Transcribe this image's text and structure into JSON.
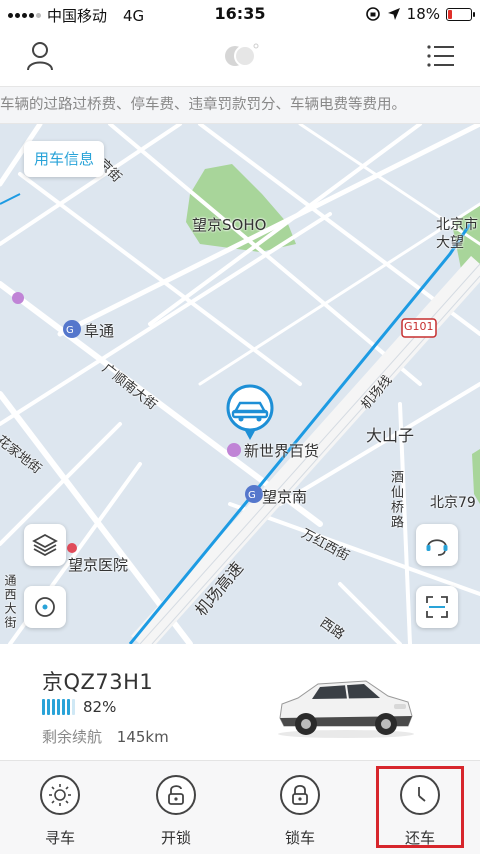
{
  "status_bar": {
    "carrier": "中国移动",
    "network": "4G",
    "time": "16:35",
    "battery": "18%",
    "battery_level": 0.18,
    "battery_color": "#e0302a"
  },
  "header": {
    "left_icon": "user-icon",
    "center_icon": "brand-logo",
    "right_icon": "menu-icon"
  },
  "notice": {
    "text": "车辆的过路过桥费、停车费、违章罚款罚分、车辆电费等费用。"
  },
  "map": {
    "usage_info_label": "用车信息",
    "labels": {
      "soho": "望京SOHO",
      "futong": "阜通",
      "xinshijie": "新世界百货",
      "dashanzi": "大山子",
      "wangjingnan": "望京南",
      "wangjing_hospital": "望京医院",
      "jichangxian": "机场线",
      "jichang_gaosu": "机场高速",
      "wanhong_xijie": "万红西街",
      "guangshun_nandajie": "广顺南大街",
      "jiuxian_qiaolu": "酒仙桥路",
      "huajia_dijie": "花家地街",
      "g101": "G101",
      "beijing_dawang": "北京市大望",
      "beijing79": "北京79",
      "top_street": "京街",
      "left_street": "通西大街",
      "bottom_road": "西路"
    },
    "colors": {
      "water": "#dde6ef",
      "park": "#a8d59a",
      "road": "#ffffff",
      "metro": "#1d9be3"
    }
  },
  "car": {
    "plate": "京QZ73H1",
    "battery_percent": "82%",
    "battery_fraction": 0.82,
    "range_label": "剩余续航",
    "range_value": "145km"
  },
  "nav": {
    "items": [
      {
        "label": "寻车",
        "icon": "sun-locate-icon"
      },
      {
        "label": "开锁",
        "icon": "unlock-icon"
      },
      {
        "label": "锁车",
        "icon": "lock-icon"
      },
      {
        "label": "还车",
        "icon": "clock-icon"
      }
    ],
    "highlight_color": "#d7262c"
  }
}
